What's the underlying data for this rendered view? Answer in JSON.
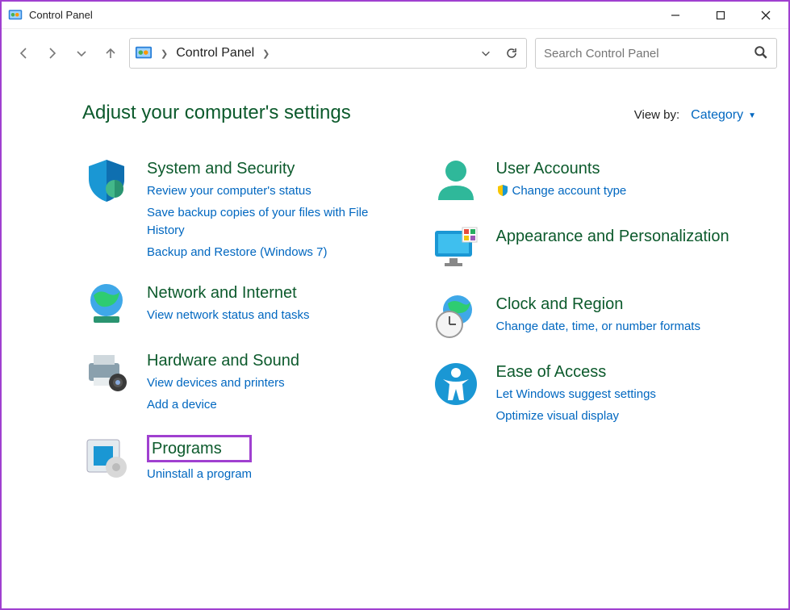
{
  "window": {
    "title": "Control Panel"
  },
  "address": {
    "path": "Control Panel"
  },
  "search": {
    "placeholder": "Search Control Panel"
  },
  "header": {
    "title": "Adjust your computer's settings",
    "viewby_label": "View by:",
    "viewby_value": "Category"
  },
  "left": [
    {
      "title": "System and Security",
      "links": [
        "Review your computer's status",
        "Save backup copies of your files with File History",
        "Backup and Restore (Windows 7)"
      ]
    },
    {
      "title": "Network and Internet",
      "links": [
        "View network status and tasks"
      ]
    },
    {
      "title": "Hardware and Sound",
      "links": [
        "View devices and printers",
        "Add a device"
      ]
    },
    {
      "title": "Programs",
      "links": [
        "Uninstall a program"
      ]
    }
  ],
  "right": [
    {
      "title": "User Accounts",
      "links": [
        "Change account type"
      ]
    },
    {
      "title": "Appearance and Personalization",
      "links": []
    },
    {
      "title": "Clock and Region",
      "links": [
        "Change date, time, or number formats"
      ]
    },
    {
      "title": "Ease of Access",
      "links": [
        "Let Windows suggest settings",
        "Optimize visual display"
      ]
    }
  ]
}
